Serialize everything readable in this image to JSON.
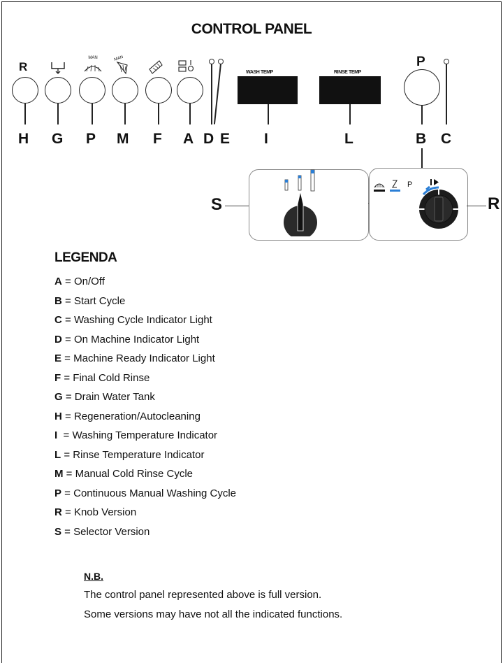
{
  "title": "CONTROL PANEL",
  "top_labels": [
    "R",
    "P"
  ],
  "button_icons": [
    "drain-icon",
    "manual-wash-icon",
    "manual-cold-rinse-icon",
    "final-cold-rinse-icon",
    "on-off-icon"
  ],
  "icon_texts": {
    "man1": "MAN",
    "man2": "MAN"
  },
  "letters": [
    "H",
    "G",
    "P",
    "M",
    "F",
    "A",
    "D",
    "E",
    "I",
    "L",
    "B",
    "C"
  ],
  "displays": {
    "wash": "WASH TEMP",
    "rinse": "RINSE TEMP"
  },
  "selector": {
    "side_label": "S",
    "knob_mark": "P"
  },
  "knob": {
    "side_label": "R"
  },
  "colors": {
    "accent_blue": "#2b7fd6"
  },
  "legend": {
    "title": "LEGENDA",
    "items": [
      {
        "key": "A",
        "sep": " = ",
        "text": "On/Off"
      },
      {
        "key": "B",
        "sep": " = ",
        "text": "Start Cycle"
      },
      {
        "key": "C",
        "sep": " = ",
        "text": "Washing Cycle Indicator Light"
      },
      {
        "key": "D",
        "sep": " = ",
        "text": "On Machine Indicator Light"
      },
      {
        "key": "E",
        "sep": " = ",
        "text": "Machine Ready Indicator Light"
      },
      {
        "key": "F",
        "sep": " = ",
        "text": "Final Cold Rinse"
      },
      {
        "key": "G",
        "sep": " = ",
        "text": "Drain Water Tank"
      },
      {
        "key": "H",
        "sep": " = ",
        "text": "Regeneration/Autocleaning"
      },
      {
        "key": "I",
        "sep": "  = ",
        "text": "Washing Temperature Indicator"
      },
      {
        "key": "L",
        "sep": " = ",
        "text": "Rinse Temperature Indicator"
      },
      {
        "key": "M",
        "sep": " = ",
        "text": "Manual Cold Rinse Cycle"
      },
      {
        "key": "P",
        "sep": " = ",
        "text": "Continuous Manual Washing Cycle"
      },
      {
        "key": "R",
        "sep": " = ",
        "text": "Knob Version"
      },
      {
        "key": "S",
        "sep": " = ",
        "text": "Selector Version"
      }
    ]
  },
  "note": {
    "title": "N.B.",
    "lines": [
      "The control panel represented above is full version.",
      "Some versions may have not all the indicated functions."
    ]
  }
}
